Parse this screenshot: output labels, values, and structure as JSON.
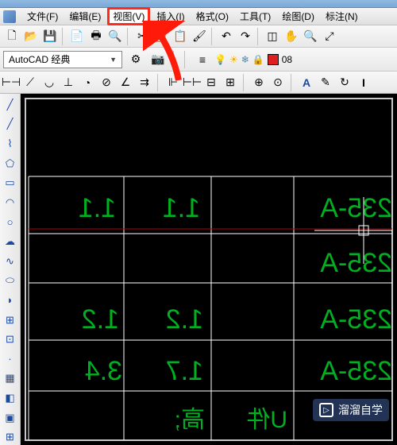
{
  "menu": {
    "file": "文件(F)",
    "edit": "编辑(E)",
    "view": "视图(V)",
    "insert": "插入(I)",
    "format": "格式(O)",
    "tools": "工具(T)",
    "draw": "绘图(D)",
    "annotate": "标注(N)"
  },
  "style": {
    "workspace": "AutoCAD 经典",
    "layer_name": "08"
  },
  "drawing": {
    "rows": [
      {
        "c1": "1.1",
        "c2": "1.1",
        "c3": "235-A"
      },
      {
        "c1": "",
        "c2": "",
        "c3": "235-A"
      },
      {
        "c1": "1.2",
        "c2": "1.2",
        "c3": "235-A"
      },
      {
        "c1": "3.4",
        "c2": "1.7",
        "c3": "235-A"
      }
    ],
    "bottom_note": "高;",
    "bottom_text": "U件"
  },
  "icons": {
    "new": "🗋",
    "open": "📂",
    "save": "💾",
    "sheet": "📄",
    "plot": "🖶",
    "preview": "🔍",
    "cut": "✂",
    "copy": "📋",
    "paste": "📋",
    "undo": "↶",
    "redo": "↷",
    "match": "🖌",
    "block": "◫",
    "zoom": "🔍",
    "pan": "✋",
    "zoom_extents": "⤢",
    "bulb_on": "💡",
    "sun": "☀",
    "lock": "🔒",
    "freeze": "❄",
    "gear": "⚙",
    "camera": "📷",
    "text_a": "A",
    "text_i": "I"
  },
  "watermark": {
    "text": "溜溜自学",
    "icon": "▷"
  }
}
